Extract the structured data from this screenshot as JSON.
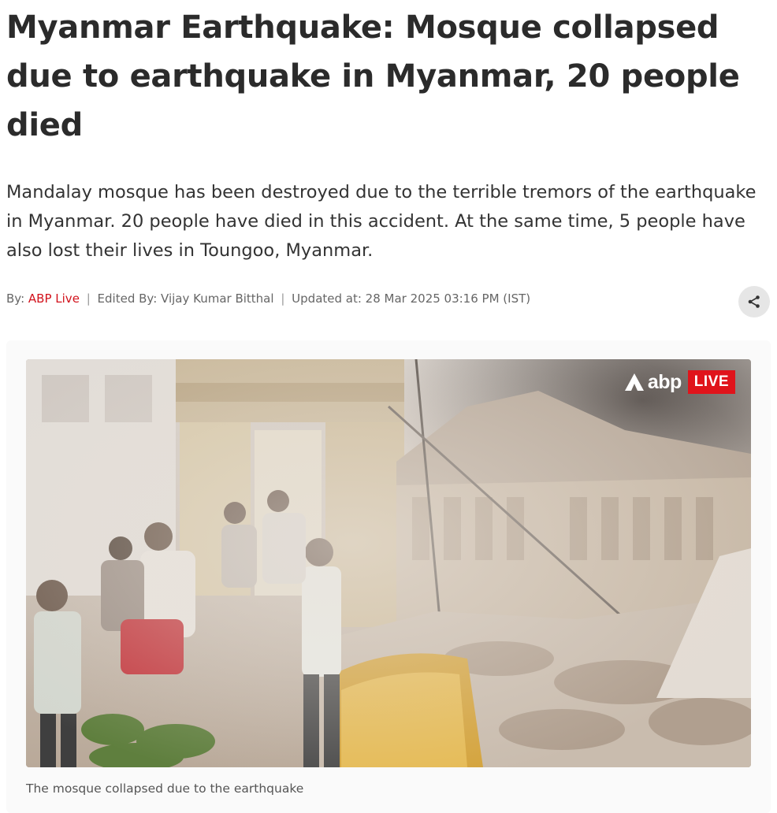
{
  "article": {
    "headline": "Myanmar Earthquake: Mosque collapsed due to earthquake in Myanmar, 20 people died",
    "summary": "Mandalay mosque has been destroyed due to the terrible tremors of the earthquake in Myanmar. 20 people have died in this accident. At the same time, 5 people have also lost their lives in Toungoo, Myanmar."
  },
  "byline": {
    "by_label": "By:",
    "author": "ABP Live",
    "separator": "|",
    "edited_by": "Edited By: Vijay Kumar Bitthal",
    "updated": "Updated at: 28 Mar 2025 03:16 PM (IST)"
  },
  "share": {
    "icon": "share-icon"
  },
  "media": {
    "logo_text": "abp",
    "live_badge": "LIVE",
    "caption": "The mosque collapsed due to the earthquake"
  },
  "colors": {
    "accent": "#d2111b",
    "live_badge": "#e0141b",
    "headline": "#2b2b2b",
    "body_text": "#333333",
    "meta_text": "#666666"
  }
}
